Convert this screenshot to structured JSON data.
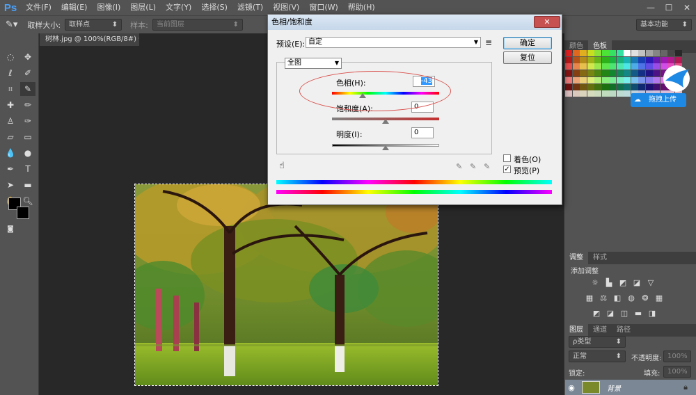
{
  "app": {
    "logo": "Ps"
  },
  "menu": {
    "items": [
      "文件(F)",
      "编辑(E)",
      "图像(I)",
      "图层(L)",
      "文字(Y)",
      "选择(S)",
      "滤镜(T)",
      "视图(V)",
      "窗口(W)",
      "帮助(H)"
    ]
  },
  "window_controls": {
    "minimize": "—",
    "maximize": "☐",
    "close": "✕"
  },
  "options_bar": {
    "sample_size_label": "取样大小:",
    "sample_size_value": "取样点",
    "sample_label": "样本:",
    "sample_value": "当前图层",
    "workspace": "基本功能"
  },
  "document": {
    "tab_title": "树林.jpg @ 100%(RGB/8#) *",
    "tab_close": "×"
  },
  "right_panel": {
    "color_tab": "颜色",
    "swatches_tab": "色板",
    "adjust_tab": "调整",
    "styles_tab": "样式",
    "add_adjustment": "添加调整",
    "layers_tab": "图层",
    "channels_tab": "通道",
    "paths_tab": "路径",
    "kind_label": "ρ类型",
    "blend_mode": "正常",
    "opacity_label": "不透明度:",
    "opacity_value": "100%",
    "lock_label": "锁定:",
    "fill_label": "填充:",
    "fill_value": "100%",
    "layer_name": "背景"
  },
  "dialog": {
    "title": "色相/饱和度",
    "close": "✕",
    "preset_label": "预设(E):",
    "preset_value": "自定",
    "channel_value": "全图",
    "hue_label": "色相(H):",
    "hue_value": "-43",
    "saturation_label": "饱和度(A):",
    "saturation_value": "0",
    "lightness_label": "明度(I):",
    "lightness_value": "0",
    "ok_button": "确定",
    "reset_button": "复位",
    "colorize_label": "着色(O)",
    "colorize_checked": false,
    "preview_label": "预览(P)",
    "preview_checked": true,
    "hue_fraction": 0.283,
    "saturation_fraction": 0.5,
    "lightness_fraction": 0.5
  },
  "overlay": {
    "baidu_label": "拖拽上传"
  },
  "colors": {
    "annotation": "#d9534f",
    "accent": "#1e88e5"
  }
}
